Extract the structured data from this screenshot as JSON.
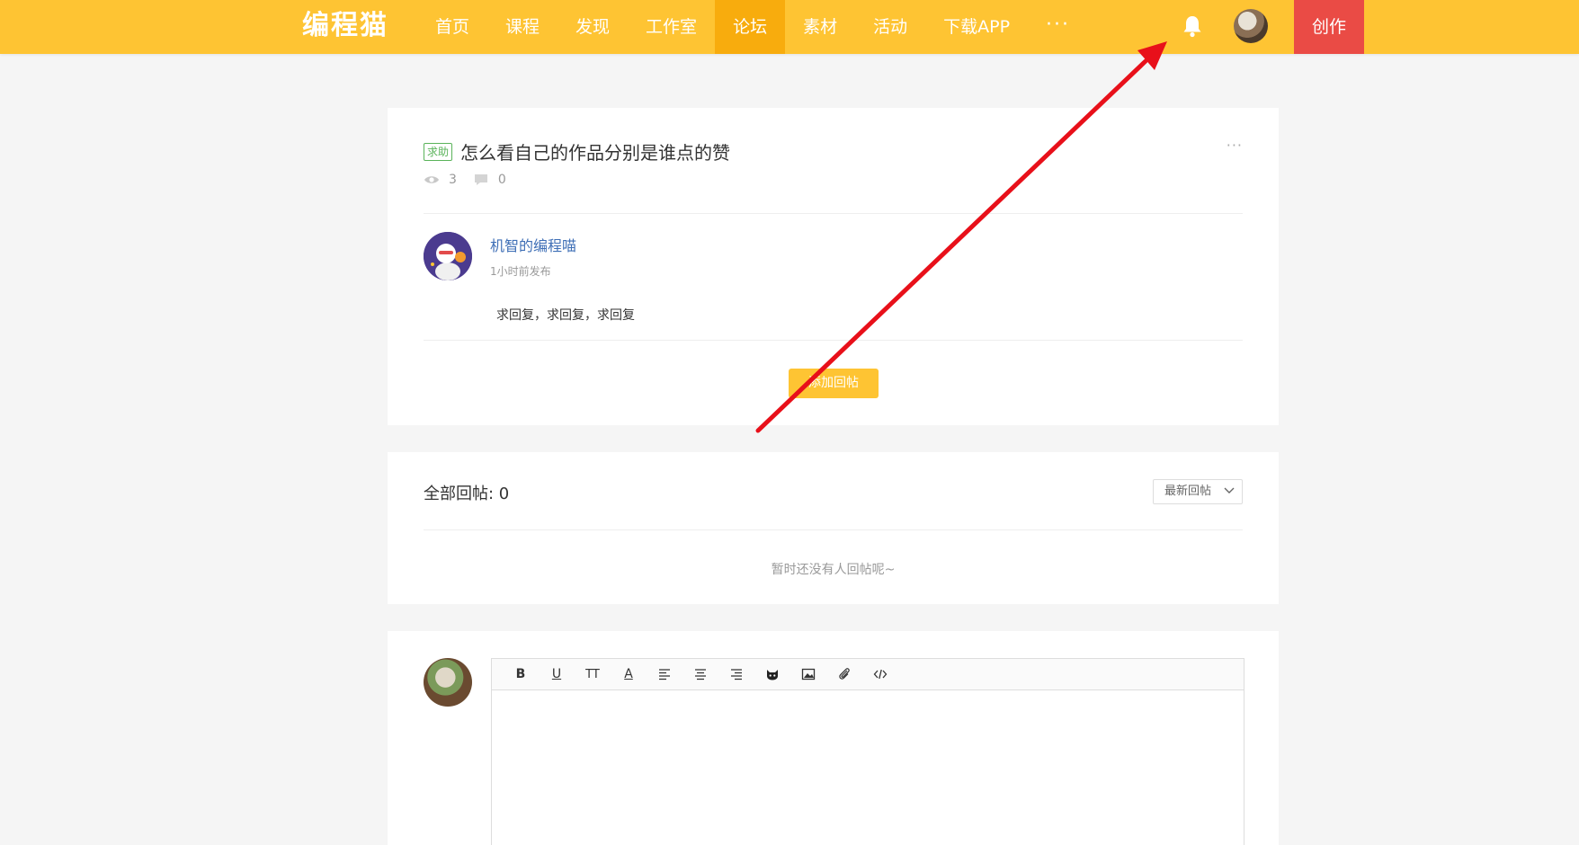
{
  "header": {
    "logo": "编程猫",
    "nav": [
      "首页",
      "课程",
      "发现",
      "工作室",
      "论坛",
      "素材",
      "活动",
      "下载APP"
    ],
    "active_nav": "论坛",
    "more": "···",
    "create": "创作"
  },
  "post": {
    "tag": "求助",
    "title": "怎么看自己的作品分别是谁点的赞",
    "more": "···",
    "views": "3",
    "comments": "0",
    "author": "机智的编程喵",
    "time": "1小时前发布",
    "body": "求回复，求回复，求回复",
    "reply_button": "添加回帖"
  },
  "replies": {
    "title": "全部回帖: 0",
    "sort": "最新回帖",
    "empty": "暂时还没有人回帖呢~"
  },
  "editor": {
    "tools": [
      "B",
      "U",
      "TT",
      "A",
      "align-left",
      "align-center",
      "align-right",
      "emoji",
      "image",
      "attachment",
      "code"
    ]
  },
  "colors": {
    "primary": "#fec433",
    "active": "#f8ac0d",
    "create": "#ea4b45",
    "tag": "#5ab35a",
    "link": "#3f6fb6",
    "annotation": "#e8101a"
  },
  "icons": [
    "bell-icon",
    "eye-icon",
    "comment-icon",
    "chevron-down-icon"
  ]
}
